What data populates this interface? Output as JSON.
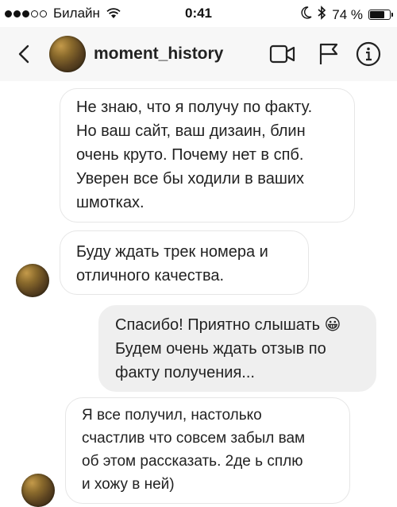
{
  "status_bar": {
    "carrier": "Билайн",
    "time": "0:41",
    "battery": "74 %",
    "battery_level": 0.74,
    "icons": [
      "signal-dots",
      "wifi-icon",
      "moon-icon",
      "bluetooth-icon",
      "battery-icon"
    ]
  },
  "header": {
    "username": "moment_history",
    "icons": [
      "back-chevron-icon",
      "video-camera-icon",
      "flag-icon",
      "info-icon"
    ]
  },
  "messages": [
    {
      "from": "them",
      "text": "Не знаю, что я получу по факту.\nНо ваш сайт, ваш дизаин, блин\nочень круто. Почему нет в спб.\nУверен все бы ходили в ваших\nшмотках."
    },
    {
      "from": "them",
      "text": "Буду ждать трек номера и\nотличного качества."
    },
    {
      "from": "me",
      "text": "Спасибо! Приятно слышать 😀\nБудем очень ждать отзыв по\nфакту получения..."
    },
    {
      "from": "them",
      "text": "Я все получил, настолько\nсчастлив что совсем забыл вам\nоб этом рассказать. 2де ь сплю\nи хожу в ней)"
    }
  ]
}
